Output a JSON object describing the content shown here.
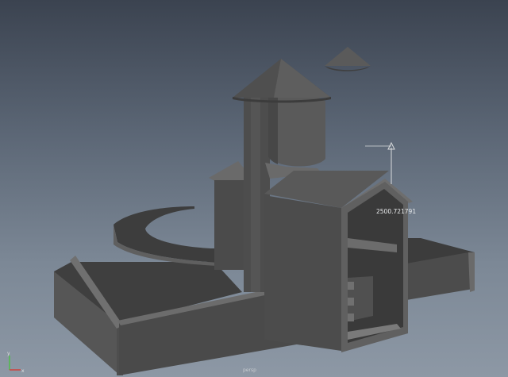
{
  "viewport": {
    "distance_readout": "2500.721791",
    "camera_label": "persp"
  },
  "axis_gizmo": {
    "x_label": "x",
    "y_label": "y",
    "x_color": "#d0413c",
    "y_color": "#4fbf4a"
  },
  "colors": {
    "background_top": "#3b4350",
    "background_bottom": "#8d98a5",
    "model_dark": "#4a4a4a",
    "model_mid": "#5a5a5a",
    "model_light": "#6a6a6a",
    "manipulator": "#c8ccd0"
  }
}
